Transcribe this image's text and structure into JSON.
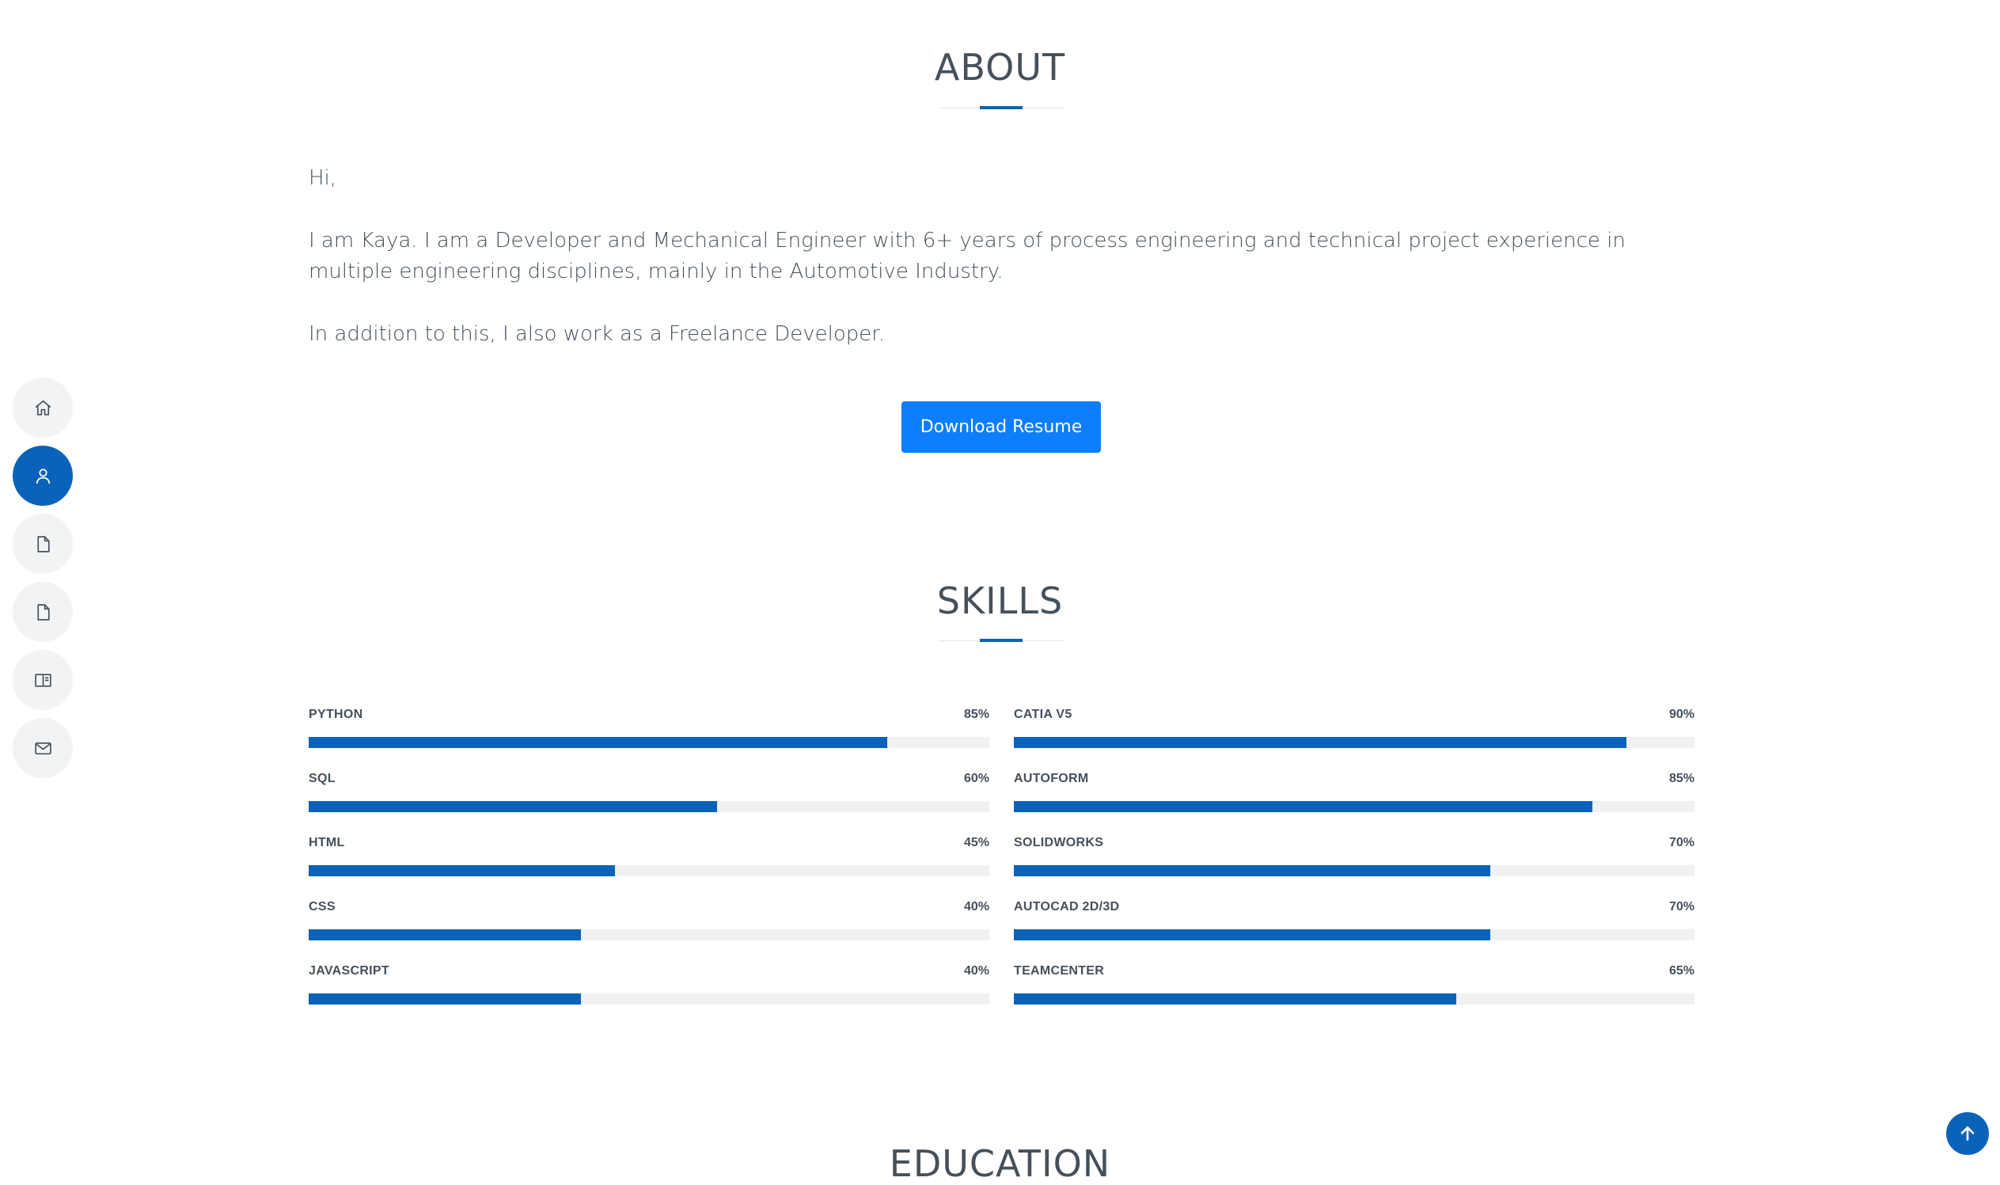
{
  "nav": {
    "items": [
      {
        "icon": "home-icon",
        "active": false
      },
      {
        "icon": "person-icon",
        "active": true
      },
      {
        "icon": "file-icon",
        "active": false
      },
      {
        "icon": "file-icon",
        "active": false
      },
      {
        "icon": "book-icon",
        "active": false
      },
      {
        "icon": "envelope-icon",
        "active": false
      }
    ]
  },
  "about": {
    "title": "ABOUT",
    "greeting": "Hi,",
    "paragraph1": "I am Kaya. I am a Developer and Mechanical Engineer with 6+ years of process engineering and technical project experience in multiple engineering disciplines, mainly in the Automotive Industry.",
    "paragraph2": "In addition to this, I also work as a Freelance Developer.",
    "download_label": "Download Resume"
  },
  "skills": {
    "title": "SKILLS",
    "left": [
      {
        "name": "PYTHON",
        "value_label": "85%",
        "value": 85
      },
      {
        "name": "SQL",
        "value_label": "60%",
        "value": 60
      },
      {
        "name": "HTML",
        "value_label": "45%",
        "value": 45
      },
      {
        "name": "CSS",
        "value_label": "40%",
        "value": 40
      },
      {
        "name": "JAVASCRIPT",
        "value_label": "40%",
        "value": 40
      }
    ],
    "right": [
      {
        "name": "CATIA V5",
        "value_label": "90%",
        "value": 90
      },
      {
        "name": "AUTOFORM",
        "value_label": "85%",
        "value": 85
      },
      {
        "name": "SOLIDWORKS",
        "value_label": "70%",
        "value": 70
      },
      {
        "name": "AUTOCAD 2D/3D",
        "value_label": "70%",
        "value": 70
      },
      {
        "name": "TEAMCENTER",
        "value_label": "65%",
        "value": 65
      }
    ]
  },
  "education": {
    "title": "EDUCATION"
  },
  "colors": {
    "accent": "#0b63b9",
    "button": "#0d7efc",
    "text": "#45505b",
    "track": "#f0f1f2"
  }
}
